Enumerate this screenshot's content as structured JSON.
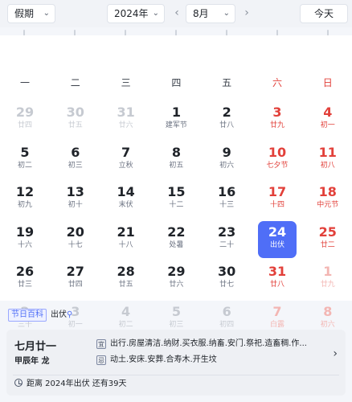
{
  "toolbar": {
    "holiday_select": "假期",
    "year_select": "2024年",
    "month_select": "8月",
    "prev_label": "‹",
    "next_label": "›",
    "today_label": "今天"
  },
  "weekdays": [
    "一",
    "二",
    "三",
    "四",
    "五",
    "六",
    "日"
  ],
  "days": [
    {
      "d": "29",
      "l": "廿四",
      "dim": true
    },
    {
      "d": "30",
      "l": "廿五",
      "dim": true
    },
    {
      "d": "31",
      "l": "廿六",
      "dim": true
    },
    {
      "d": "1",
      "l": "建军节"
    },
    {
      "d": "2",
      "l": "廿八"
    },
    {
      "d": "3",
      "l": "廿九"
    },
    {
      "d": "4",
      "l": "初一"
    },
    {
      "d": "5",
      "l": "初二"
    },
    {
      "d": "6",
      "l": "初三"
    },
    {
      "d": "7",
      "l": "立秋"
    },
    {
      "d": "8",
      "l": "初五"
    },
    {
      "d": "9",
      "l": "初六"
    },
    {
      "d": "10",
      "l": "七夕节"
    },
    {
      "d": "11",
      "l": "初八"
    },
    {
      "d": "12",
      "l": "初九"
    },
    {
      "d": "13",
      "l": "初十"
    },
    {
      "d": "14",
      "l": "末伏"
    },
    {
      "d": "15",
      "l": "十二"
    },
    {
      "d": "16",
      "l": "十三"
    },
    {
      "d": "17",
      "l": "十四"
    },
    {
      "d": "18",
      "l": "中元节"
    },
    {
      "d": "19",
      "l": "十六"
    },
    {
      "d": "20",
      "l": "十七"
    },
    {
      "d": "21",
      "l": "十八"
    },
    {
      "d": "22",
      "l": "处暑"
    },
    {
      "d": "23",
      "l": "二十"
    },
    {
      "d": "24",
      "l": "出伏",
      "selected": true
    },
    {
      "d": "25",
      "l": "廿二"
    },
    {
      "d": "26",
      "l": "廿三"
    },
    {
      "d": "27",
      "l": "廿四"
    },
    {
      "d": "28",
      "l": "廿五"
    },
    {
      "d": "29",
      "l": "廿六"
    },
    {
      "d": "30",
      "l": "廿七"
    },
    {
      "d": "31",
      "l": "廿八"
    },
    {
      "d": "1",
      "l": "廿九",
      "dim": true
    },
    {
      "d": "2",
      "l": "三十",
      "dim": true
    },
    {
      "d": "3",
      "l": "初一",
      "dim": true
    },
    {
      "d": "4",
      "l": "初二",
      "dim": true
    },
    {
      "d": "5",
      "l": "初三",
      "dim": true
    },
    {
      "d": "6",
      "l": "初四",
      "dim": true
    },
    {
      "d": "7",
      "l": "白露",
      "dim": true
    },
    {
      "d": "8",
      "l": "初六",
      "dim": true
    }
  ],
  "panel": {
    "tag": "节日百科",
    "tag_name": "出伏",
    "lunar_date": "七月廿一",
    "ganzhi": "甲辰年 龙",
    "yi_badge": "宜",
    "yi_text": "出行.房屋清洁.纳财.买衣服.纳畜.安门.祭祀.造畜稠.作...",
    "ji_badge": "忌",
    "ji_text": "动土.安床.安葬.合寿木.开生坟",
    "countdown": "距离 2024年出伏 还有39天"
  },
  "colors": {
    "accent": "#4f6ef7",
    "weekend": "#e2403a"
  }
}
